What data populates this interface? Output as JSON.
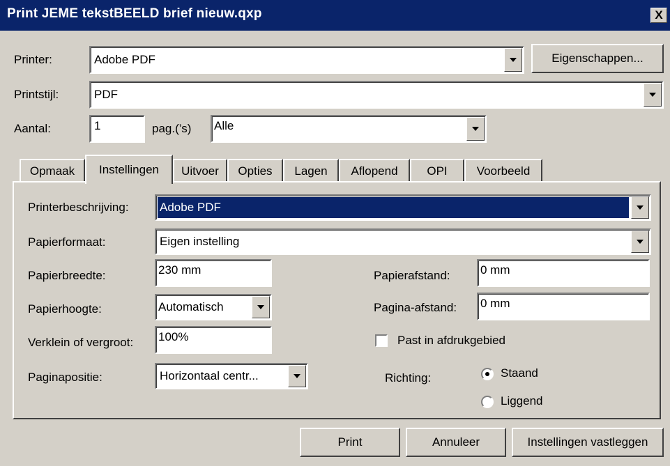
{
  "window": {
    "title": "Print JEME tekstBEELD brief nieuw.qxp",
    "close_glyph": "X"
  },
  "printer": {
    "label": "Printer:",
    "value": "Adobe PDF",
    "properties_label": "Eigenschappen..."
  },
  "style": {
    "label": "Printstijl:",
    "value": "PDF"
  },
  "copies": {
    "label": "Aantal:",
    "value": "1",
    "pages_label": "pag.(’s)",
    "pages_value": "Alle"
  },
  "tabs": [
    {
      "label": "Opmaak",
      "active": false
    },
    {
      "label": "Instellingen",
      "active": true
    },
    {
      "label": "Uitvoer",
      "active": false
    },
    {
      "label": "Opties",
      "active": false
    },
    {
      "label": "Lagen",
      "active": false
    },
    {
      "label": "Aflopend",
      "active": false
    },
    {
      "label": "OPI",
      "active": false
    },
    {
      "label": "Voorbeeld",
      "active": false
    }
  ],
  "settings": {
    "printer_description": {
      "label": "Printerbeschrijving:",
      "value": "Adobe PDF"
    },
    "paper_size": {
      "label": "Papierformaat:",
      "value": "Eigen instelling"
    },
    "paper_width": {
      "label": "Papierbreedte:",
      "value": "230 mm"
    },
    "paper_height": {
      "label": "Papierhoogte:",
      "value": "Automatisch"
    },
    "scale": {
      "label": "Verklein of vergroot:",
      "value": "100%"
    },
    "page_position": {
      "label": "Paginapositie:",
      "value": "Horizontaal centr..."
    },
    "paper_offset": {
      "label": "Papierafstand:",
      "value": "0 mm"
    },
    "page_gap": {
      "label": "Pagina-afstand:",
      "value": "0 mm"
    },
    "fit_print_area": {
      "label": "Past in afdrukgebied",
      "checked": false
    },
    "orientation": {
      "label": "Richting:",
      "options": [
        {
          "label": "Staand",
          "selected": true
        },
        {
          "label": "Liggend",
          "selected": false
        }
      ]
    }
  },
  "buttons": {
    "print": "Print",
    "cancel": "Annuleer",
    "capture": "Instellingen vastleggen"
  }
}
